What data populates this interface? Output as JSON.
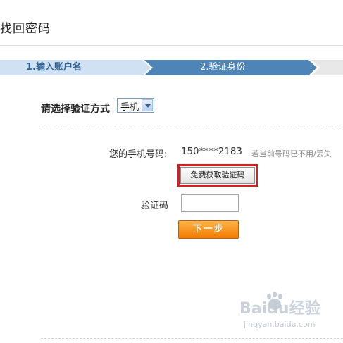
{
  "page": {
    "title": "找回密码"
  },
  "steps": [
    {
      "label": "1.输入账户名",
      "state": "done"
    },
    {
      "label": "2.验证身份",
      "state": "active"
    }
  ],
  "method": {
    "label": "请选择验证方式",
    "selected": "手机"
  },
  "phone": {
    "label": "您的手机号码:",
    "value": "150****2183",
    "hint": "若当前号码已不用/丢失"
  },
  "get_code_button": "免费获取验证码",
  "verify": {
    "label": "验证码",
    "value": ""
  },
  "next_button": "下一步",
  "watermark": {
    "brand": "Baidu经验",
    "url": "jingyan.baidu.com"
  },
  "colors": {
    "step_done": "#cfe1f2",
    "step_active": "#4f84b7",
    "highlight": "#d81e1e",
    "next_button": "#f27a00"
  }
}
